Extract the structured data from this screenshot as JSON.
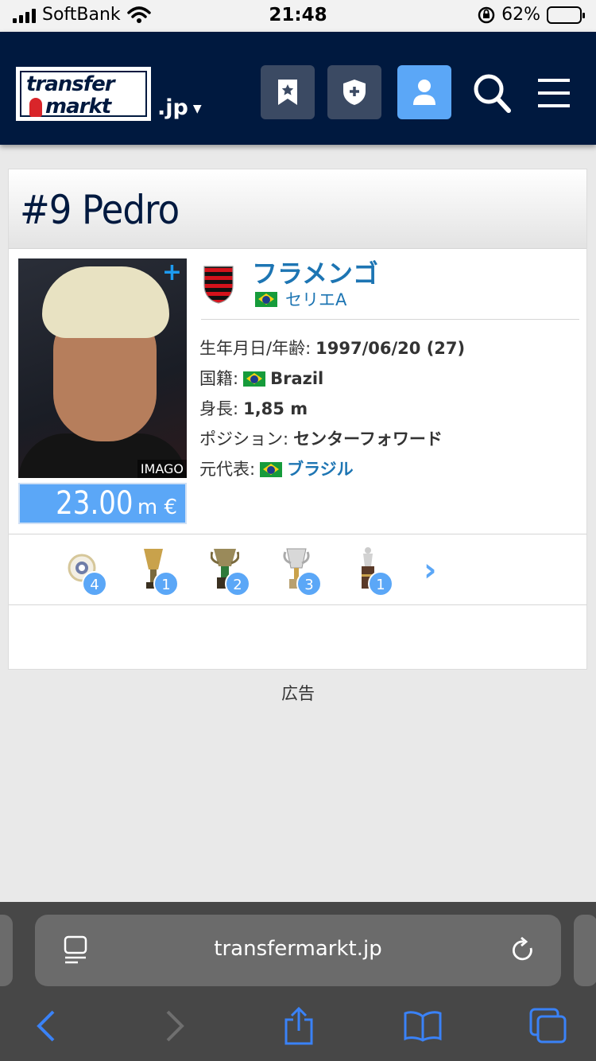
{
  "status_bar": {
    "carrier": "SoftBank",
    "time": "21:48",
    "battery": "62%",
    "battery_level": 0.62
  },
  "header": {
    "logo_line1": "transfer",
    "logo_line2": "markt",
    "domain": ".jp",
    "icons": [
      "bookmark-icon",
      "shield-plus-icon",
      "user-icon",
      "search-icon",
      "menu-icon"
    ]
  },
  "player": {
    "title": "#9 Pedro",
    "photo_credit": "IMAGO",
    "plus": "+",
    "market_value": "23.00",
    "market_value_unit": "m €",
    "club": "フラメンゴ",
    "league": "セリエA",
    "info": {
      "dob_label": "生年月日/年齢:",
      "dob_value": "1997/06/20 (27)",
      "citizenship_label": "国籍:",
      "citizenship_value": "Brazil",
      "height_label": "身長:",
      "height_value": "1,85 m",
      "position_label": "ポジション:",
      "position_value": "センターフォワード",
      "national_label": "元代表:",
      "national_value": "ブラジル"
    }
  },
  "trophies": [
    {
      "icon": "state-championship-icon",
      "count": "4"
    },
    {
      "icon": "brasileirao-trophy-icon",
      "count": "1"
    },
    {
      "icon": "copa-do-brasil-trophy-icon",
      "count": "2"
    },
    {
      "icon": "supercopa-trophy-icon",
      "count": "3"
    },
    {
      "icon": "libertadores-trophy-icon",
      "count": "1"
    }
  ],
  "ad_label": "広告",
  "safari": {
    "url": "transfermarkt.jp"
  },
  "colors": {
    "navy": "#00193f",
    "accent": "#5ba7f7",
    "link": "#1d75b3"
  }
}
